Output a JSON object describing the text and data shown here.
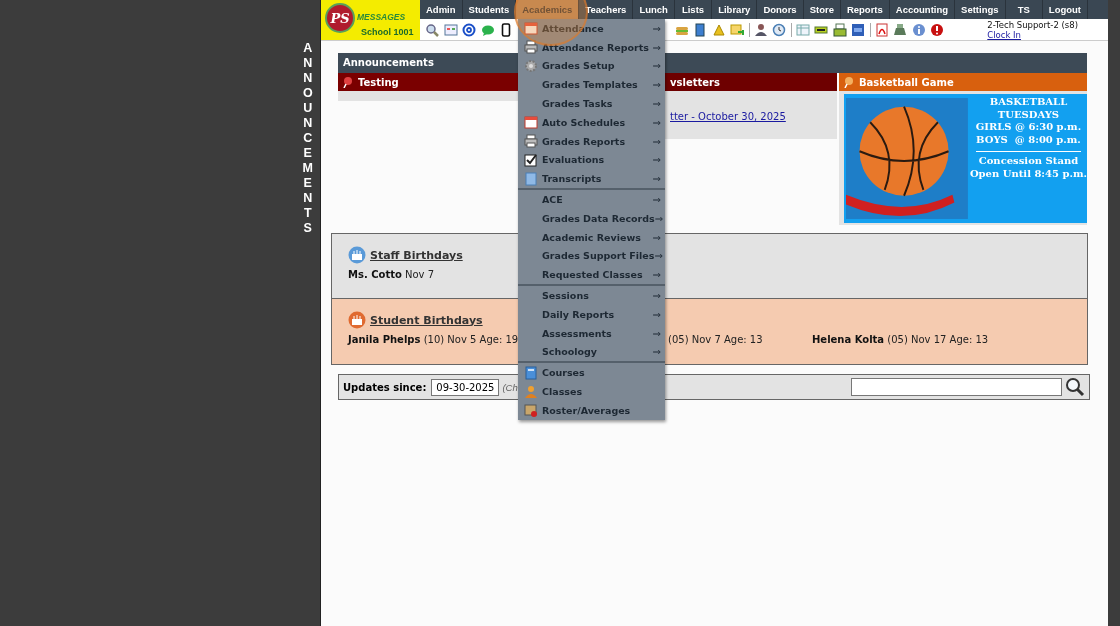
{
  "side_banner": "ANNOUNCEMENTS",
  "logo": {
    "mark": "PS",
    "name": "MESSAGES",
    "school": "School 1001"
  },
  "nav": [
    {
      "label": "Admin",
      "selected": false
    },
    {
      "label": "Students",
      "selected": false
    },
    {
      "label": "Academics",
      "selected": true
    },
    {
      "label": "Teachers",
      "selected": false
    },
    {
      "label": "Lunch",
      "selected": false
    },
    {
      "label": "Lists",
      "selected": false
    },
    {
      "label": "Library",
      "selected": false
    },
    {
      "label": "Donors",
      "selected": false
    },
    {
      "label": "Store",
      "selected": false
    },
    {
      "label": "Reports",
      "selected": false
    },
    {
      "label": "Accounting",
      "selected": false
    },
    {
      "label": "Settings",
      "selected": false
    },
    {
      "label": "TS",
      "selected": false
    },
    {
      "label": "Logout",
      "selected": false
    }
  ],
  "user": {
    "name": "2-Tech Support-2 (s8)",
    "clock_link": "Clock In"
  },
  "menu": {
    "sections": [
      [
        {
          "label": "Attendance",
          "arrow": "⇒",
          "icon": true
        },
        {
          "label": "Attendance Reports",
          "arrow": "⇒",
          "icon": true
        },
        {
          "label": "Grades Setup",
          "arrow": "⇒",
          "icon": true
        },
        {
          "label": "Grades Templates",
          "arrow": "⇒",
          "icon": false
        },
        {
          "label": "Grades Tasks",
          "arrow": "⇒",
          "icon": false
        },
        {
          "label": "Auto Schedules",
          "arrow": "⇒",
          "icon": true
        },
        {
          "label": "Grades Reports",
          "arrow": "⇒",
          "icon": true
        },
        {
          "label": "Evaluations",
          "arrow": "⇒",
          "icon": true
        },
        {
          "label": "Transcripts",
          "arrow": "⇒",
          "icon": true
        }
      ],
      [
        {
          "label": "ACE",
          "arrow": "⇒",
          "icon": false
        },
        {
          "label": "Grades Data Records",
          "arrow": "⇒",
          "icon": false
        },
        {
          "label": "Academic Reviews",
          "arrow": "⇒",
          "icon": false
        },
        {
          "label": "Grades Support Files",
          "arrow": "⇒",
          "icon": false
        },
        {
          "label": "Requested Classes",
          "arrow": "⇒",
          "icon": false
        }
      ],
      [
        {
          "label": "Sessions",
          "arrow": "⇒",
          "icon": false
        },
        {
          "label": "Daily Reports",
          "arrow": "⇒",
          "icon": false
        },
        {
          "label": "Assessments",
          "arrow": "⇒",
          "icon": false
        },
        {
          "label": "Schoology",
          "arrow": "⇒",
          "icon": false
        }
      ],
      [
        {
          "label": "Courses",
          "icon": true
        },
        {
          "label": "Classes",
          "icon": true
        },
        {
          "label": "Roster/Averages",
          "icon": true
        }
      ]
    ]
  },
  "announcements": {
    "title": "Announcements",
    "columns": [
      {
        "kind": "text",
        "title": "Testing",
        "color": "#7a0000"
      },
      {
        "kind": "link",
        "title": "vsletters",
        "link": "tter - October 30, 2025",
        "color": "#6e0000"
      },
      {
        "kind": "flyer",
        "title": "Basketball Game",
        "color": "#d8600e",
        "heading_lines": [
          "BASKETBALL",
          "TUESDAYS",
          "GIRLS @ 6:30 p.m.",
          "BOYS  @ 8:00 p.m."
        ],
        "footer_lines": [
          "Concession Stand",
          "Open Until 8:45 p.m."
        ]
      }
    ]
  },
  "staff_birthdays": {
    "title": "Staff Birthdays",
    "people": [
      {
        "name": "Ms. Cotto",
        "detail": "Nov 7"
      }
    ]
  },
  "student_birthdays": {
    "title": "Student Birthdays",
    "people": [
      {
        "name": "Janila Phelps",
        "detail": "(10) Nov 5 Age: 19"
      },
      {
        "detail": "(05) Nov 7 Age: 13"
      },
      {
        "name": "Helena Kolta",
        "detail": "(05) Nov 17 Age: 13"
      }
    ]
  },
  "updates": {
    "label": "Updates since:",
    "date": "09-30-2025",
    "note": "(Ch"
  }
}
